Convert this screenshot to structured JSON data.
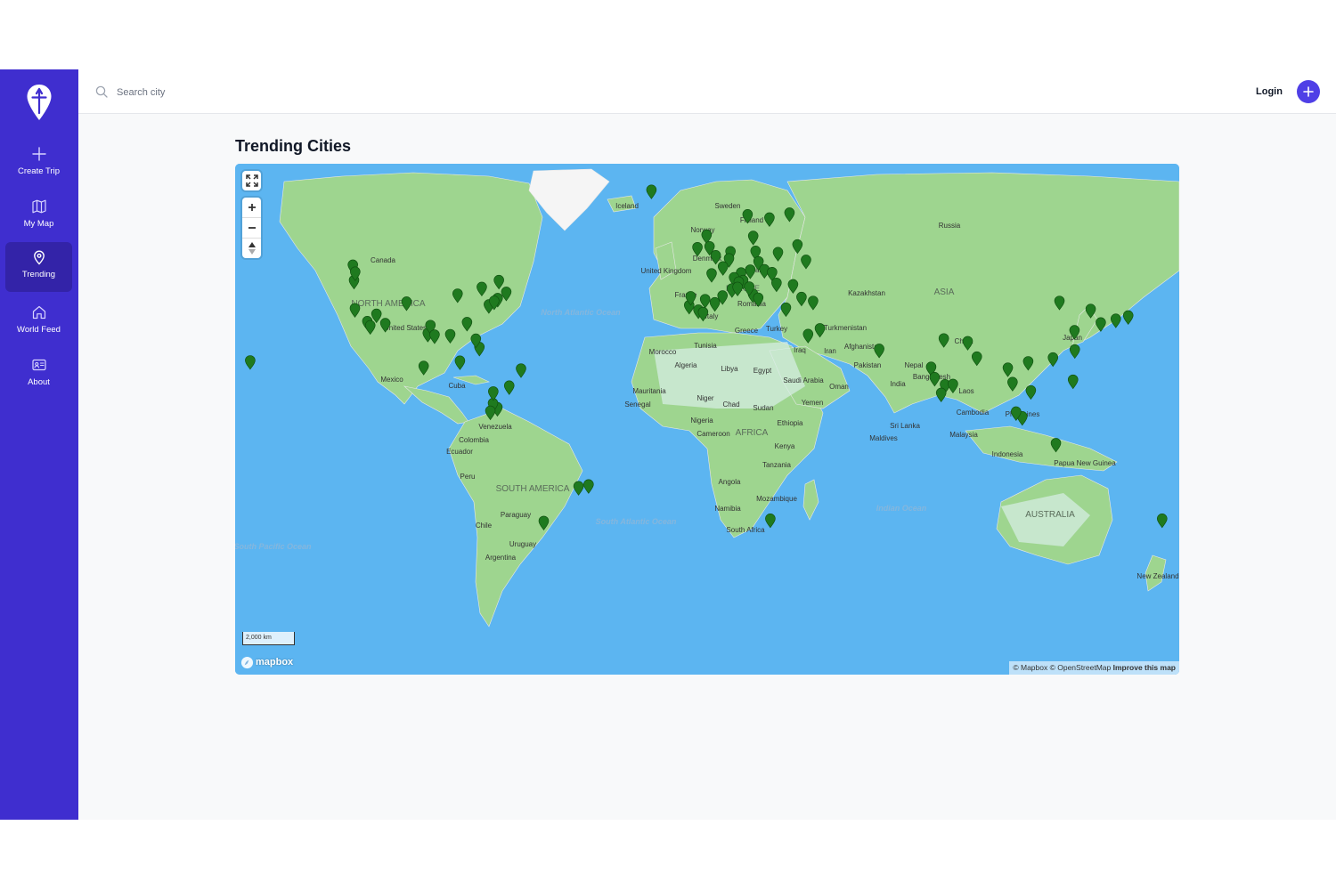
{
  "sidebar": {
    "items": [
      {
        "label": "Create Trip",
        "icon": "plus-icon"
      },
      {
        "label": "My Map",
        "icon": "map-icon"
      },
      {
        "label": "Trending",
        "icon": "location-pin-icon",
        "active": true
      },
      {
        "label": "World Feed",
        "icon": "home-icon"
      },
      {
        "label": "About",
        "icon": "id-card-icon"
      }
    ]
  },
  "header": {
    "search_placeholder": "Search city",
    "login_label": "Login",
    "add_icon": "plus-icon"
  },
  "main": {
    "title": "Trending Cities"
  },
  "map": {
    "scale_label": "2,000 km",
    "logo_text": "mapbox",
    "attribution": "© Mapbox © OpenStreetMap",
    "improve_link": "Improve this map",
    "marker_color": "#1f7a1f",
    "labels": {
      "oceans": [
        "North Atlantic Ocean",
        "South Atlantic Ocean",
        "Indian Ocean",
        "South Pacific Ocean"
      ],
      "continents": [
        "NORTH AMERICA",
        "SOUTH AMERICA",
        "AFRICA",
        "ASIA",
        "AUSTRALIA",
        "EUROPE"
      ],
      "countries": [
        "Canada",
        "United States",
        "Mexico",
        "Cuba",
        "Venezuela",
        "Colombia",
        "Ecuador",
        "Peru",
        "Paraguay",
        "Chile",
        "Uruguay",
        "Argentina",
        "Iceland",
        "Sweden",
        "Finland",
        "Norway",
        "Denmark",
        "United Kingdom",
        "Belarus",
        "France",
        "Romania",
        "Italy",
        "Greece",
        "Turkey",
        "Russia",
        "Kazakhstan",
        "Turkmenistan",
        "Afghanistan",
        "Iran",
        "Iraq",
        "Pakistan",
        "Nepal",
        "India",
        "Bangladesh",
        "China",
        "Japan",
        "Laos",
        "Cambodia",
        "Philippines",
        "Malaysia",
        "Indonesia",
        "Papua New Guinea",
        "Sri Lanka",
        "Maldives",
        "Morocco",
        "Tunisia",
        "Algeria",
        "Libya",
        "Egypt",
        "Mauritania",
        "Senegal",
        "Niger",
        "Chad",
        "Sudan",
        "Nigeria",
        "Cameroon",
        "Ethiopia",
        "Kenya",
        "Tanzania",
        "Angola",
        "Namibia",
        "Mozambique",
        "South Africa",
        "Saudi Arabia",
        "Yemen",
        "Oman",
        "New Zealand"
      ]
    },
    "markers": [
      [
        -123.1,
        49.3
      ],
      [
        -122.7,
        45.5
      ],
      [
        -122.3,
        47.6
      ],
      [
        -122.4,
        37.8
      ],
      [
        -118.2,
        34.0
      ],
      [
        -117.2,
        32.7
      ],
      [
        -115.1,
        36.2
      ],
      [
        -112.1,
        33.4
      ],
      [
        -104.9,
        39.7
      ],
      [
        -97.7,
        30.3
      ],
      [
        -96.8,
        32.8
      ],
      [
        -95.4,
        29.8
      ],
      [
        -90.1,
        29.95
      ],
      [
        -84.4,
        33.7
      ],
      [
        -80.2,
        25.8
      ],
      [
        -81.4,
        28.5
      ],
      [
        -87.6,
        41.9
      ],
      [
        -79.4,
        43.7
      ],
      [
        -73.6,
        45.5
      ],
      [
        -71.1,
        42.4
      ],
      [
        -74.0,
        40.7
      ],
      [
        -77.0,
        38.9
      ],
      [
        -75.2,
        39.95
      ],
      [
        -99.1,
        19.4
      ],
      [
        -86.8,
        21.2
      ],
      [
        -66.1,
        18.5
      ],
      [
        -70.1,
        12.5
      ],
      [
        -74.1,
        4.7
      ],
      [
        -75.6,
        6.2
      ],
      [
        -75.5,
        10.4
      ],
      [
        -76.5,
        3.4
      ],
      [
        -43.2,
        -22.9
      ],
      [
        -46.6,
        -23.5
      ],
      [
        -58.4,
        -34.6
      ],
      [
        -157.9,
        21.3
      ],
      [
        -21.9,
        64.1
      ],
      [
        10.7,
        59.9
      ],
      [
        18.1,
        59.3
      ],
      [
        24.9,
        60.2
      ],
      [
        12.6,
        55.7
      ],
      [
        -0.1,
        51.5
      ],
      [
        -6.3,
        53.3
      ],
      [
        -3.2,
        55.95
      ],
      [
        -2.2,
        53.5
      ],
      [
        4.9,
        52.4
      ],
      [
        4.4,
        50.8
      ],
      [
        13.4,
        52.5
      ],
      [
        2.35,
        48.9
      ],
      [
        -1.5,
        47.2
      ],
      [
        21.0,
        52.2
      ],
      [
        27.6,
        53.9
      ],
      [
        14.4,
        50.1
      ],
      [
        16.4,
        48.2
      ],
      [
        19.0,
        47.5
      ],
      [
        8.5,
        47.4
      ],
      [
        11.6,
        48.1
      ],
      [
        6.1,
        46.2
      ],
      [
        9.2,
        45.5
      ],
      [
        12.5,
        41.9
      ],
      [
        14.3,
        40.8
      ],
      [
        11.25,
        43.8
      ],
      [
        7.7,
        45.1
      ],
      [
        -3.7,
        40.4
      ],
      [
        2.2,
        41.4
      ],
      [
        -9.1,
        38.7
      ],
      [
        -8.6,
        41.2
      ],
      [
        -5.98,
        37.4
      ],
      [
        -4.4,
        36.7
      ],
      [
        -0.4,
        39.5
      ],
      [
        5.4,
        43.3
      ],
      [
        7.3,
        43.7
      ],
      [
        23.7,
        38.0
      ],
      [
        28.97,
        41.0
      ],
      [
        30.5,
        50.45
      ],
      [
        26.1,
        44.4
      ],
      [
        20.5,
        44.8
      ],
      [
        32.9,
        39.9
      ],
      [
        31.2,
        30.0
      ],
      [
        35.2,
        31.8
      ],
      [
        55.3,
        25.2
      ],
      [
        72.9,
        19.1
      ],
      [
        77.2,
        28.6
      ],
      [
        77.6,
        12.97
      ],
      [
        80.3,
        13.1
      ],
      [
        76.3,
        9.9
      ],
      [
        74.1,
        15.5
      ],
      [
        88.4,
        22.6
      ],
      [
        85.3,
        27.7
      ],
      [
        100.5,
        13.75
      ],
      [
        103.8,
        1.35
      ],
      [
        101.7,
        3.1
      ],
      [
        115.2,
        -8.4
      ],
      [
        106.7,
        10.8
      ],
      [
        105.8,
        21.0
      ],
      [
        98.9,
        18.8
      ],
      [
        121.0,
        14.6
      ],
      [
        114.2,
        22.3
      ],
      [
        121.5,
        31.2
      ],
      [
        116.4,
        39.9
      ],
      [
        126.98,
        37.6
      ],
      [
        139.7,
        35.7
      ],
      [
        135.5,
        34.7
      ],
      [
        130.4,
        33.6
      ],
      [
        121.6,
        25.0
      ],
      [
        151.2,
        -33.9
      ],
      [
        18.4,
        -33.9
      ]
    ]
  }
}
